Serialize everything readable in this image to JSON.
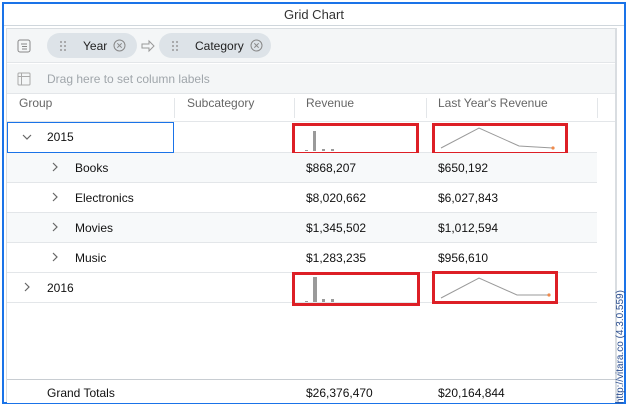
{
  "window": {
    "title": "Grid Chart"
  },
  "grouping": {
    "chips": [
      {
        "label": "Year"
      },
      {
        "label": "Category"
      }
    ],
    "drag_hint": "Drag here to set column labels"
  },
  "columns": {
    "group": "Group",
    "subcategory": "Subcategory",
    "revenue": "Revenue",
    "last_year_revenue": "Last Year's Revenue"
  },
  "rows": [
    {
      "group": "2015",
      "expanded": true,
      "revenue_sparkline": "bar",
      "last_year_sparkline": "line"
    },
    {
      "category": "Books",
      "revenue": "$868,207",
      "last_year_revenue": "$650,192"
    },
    {
      "category": "Electronics",
      "revenue": "$8,020,662",
      "last_year_revenue": "$6,027,843"
    },
    {
      "category": "Movies",
      "revenue": "$1,345,502",
      "last_year_revenue": "$1,012,594"
    },
    {
      "category": "Music",
      "revenue": "$1,283,235",
      "last_year_revenue": "$956,610"
    },
    {
      "group": "2016",
      "expanded": false,
      "revenue_sparkline": "bar",
      "last_year_sparkline": "line"
    }
  ],
  "totals": {
    "label": "Grand Totals",
    "revenue": "$26,376,470",
    "last_year_revenue": "$20,164,844"
  },
  "footer": {
    "credit": "http://vitara.co (4.3.0.559)"
  },
  "colors": {
    "accent": "#1a73e8",
    "highlight": "#dd1f26",
    "spark": "#9a9a9a",
    "spark_end": "#f08a4b"
  },
  "icons": [
    "group-panel-icon",
    "drag-grip-icon",
    "remove-icon",
    "arrow-right-icon",
    "column-labels-icon",
    "chevron-down-icon",
    "chevron-right-icon"
  ]
}
